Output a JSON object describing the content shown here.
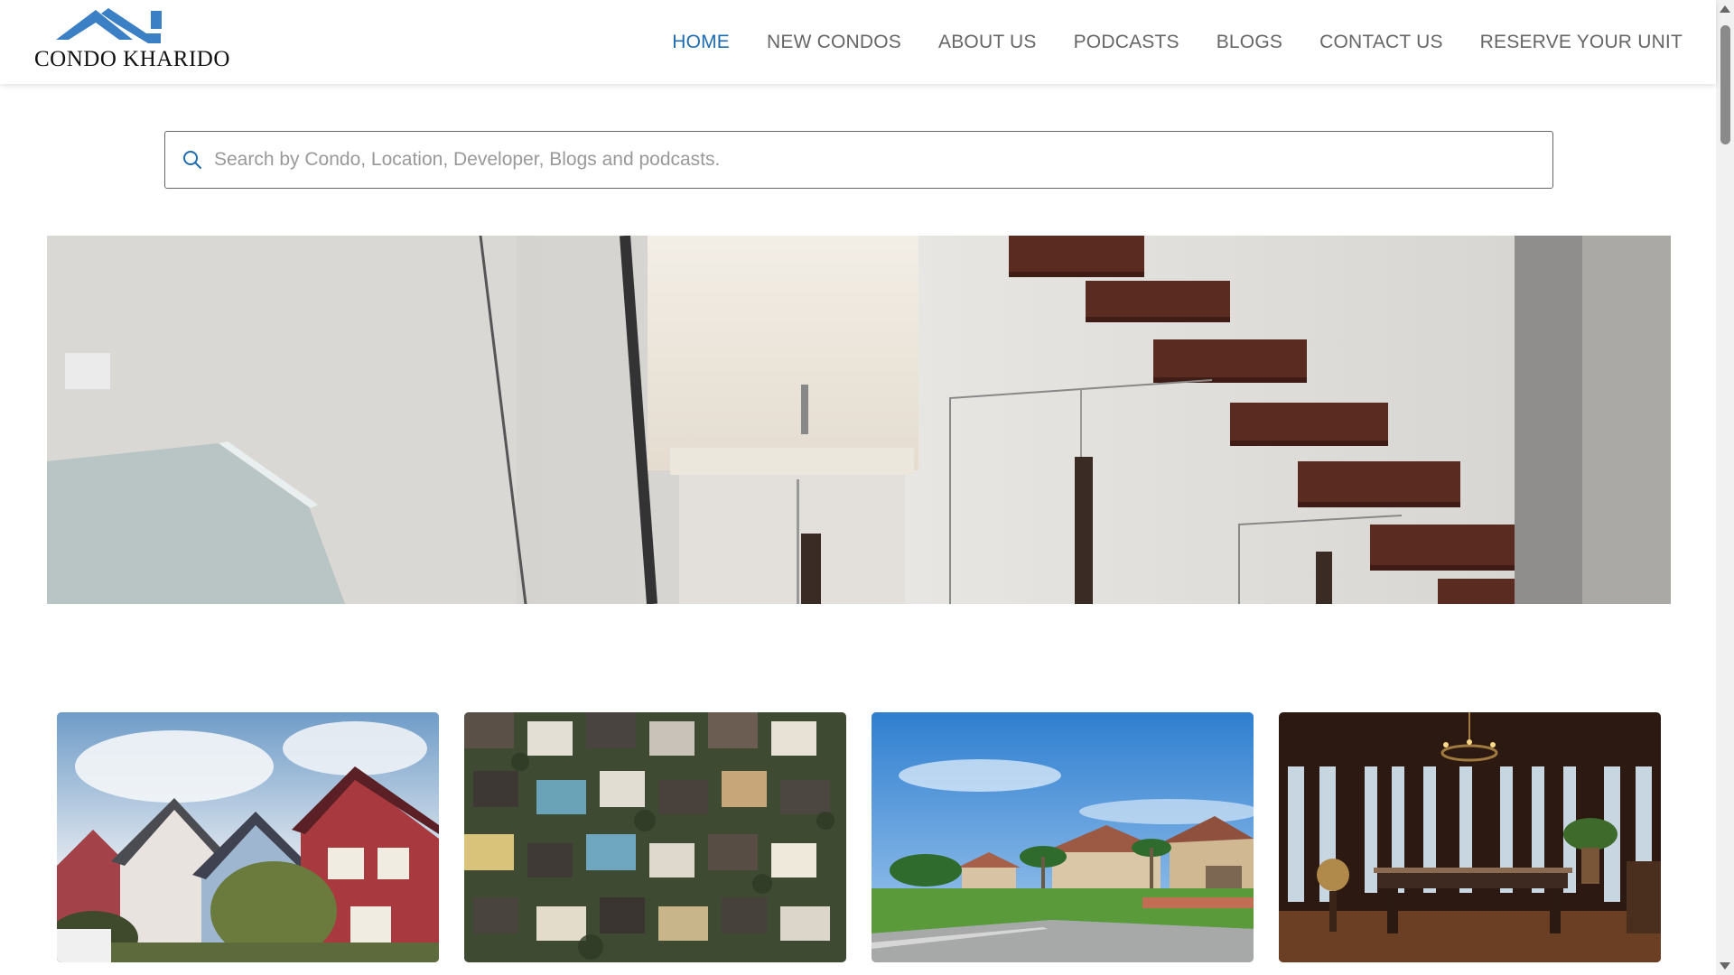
{
  "brand": {
    "name": "CONDO KHARIDO",
    "color": "#3b7fc4"
  },
  "nav": {
    "items": [
      {
        "label": "HOME",
        "active": true
      },
      {
        "label": "NEW CONDOS"
      },
      {
        "label": "ABOUT US"
      },
      {
        "label": "PODCASTS"
      },
      {
        "label": "BLOGS"
      },
      {
        "label": "CONTACT US"
      },
      {
        "label": "RESERVE YOUR UNIT"
      }
    ]
  },
  "search": {
    "placeholder": "Search by Condo, Location, Developer, Blogs and podcasts.",
    "value": "",
    "icon": "search-icon"
  },
  "hero": {
    "image": "interior-floating-staircase"
  },
  "cards": [
    {
      "image": "colorful-houses-sunny-sky"
    },
    {
      "image": "aerial-neighborhood-rooftops"
    },
    {
      "image": "suburban-street-villas"
    },
    {
      "image": "dark-wood-dining-room"
    }
  ],
  "colors": {
    "accent": "#1f6bb0",
    "nav_text": "#666666"
  }
}
